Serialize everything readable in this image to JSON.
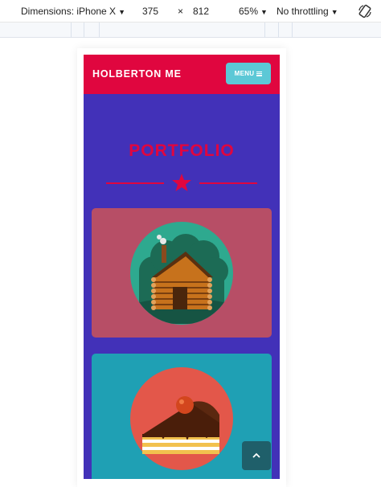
{
  "devtools": {
    "dimensions_label": "Dimensions: iPhone X",
    "width": "375",
    "times": "×",
    "height": "812",
    "zoom": "65%",
    "throttling": "No throttling",
    "caret": "▼"
  },
  "site": {
    "brand": "HOLBERTON ME",
    "menu_label": "MENU",
    "section_title": "PORTFOLIO",
    "scroll_top_icon": "chevron-up-icon"
  },
  "colors": {
    "page_bg": "#4231b8",
    "accent": "#e0063f",
    "menu_button": "#5cc8d6",
    "card_1": "#b74e66",
    "card_2": "#1fa0b4",
    "scroll_top": "#1f5f6a"
  },
  "portfolio": [
    {
      "icon": "log-cabin-icon"
    },
    {
      "icon": "cake-slice-icon"
    }
  ]
}
